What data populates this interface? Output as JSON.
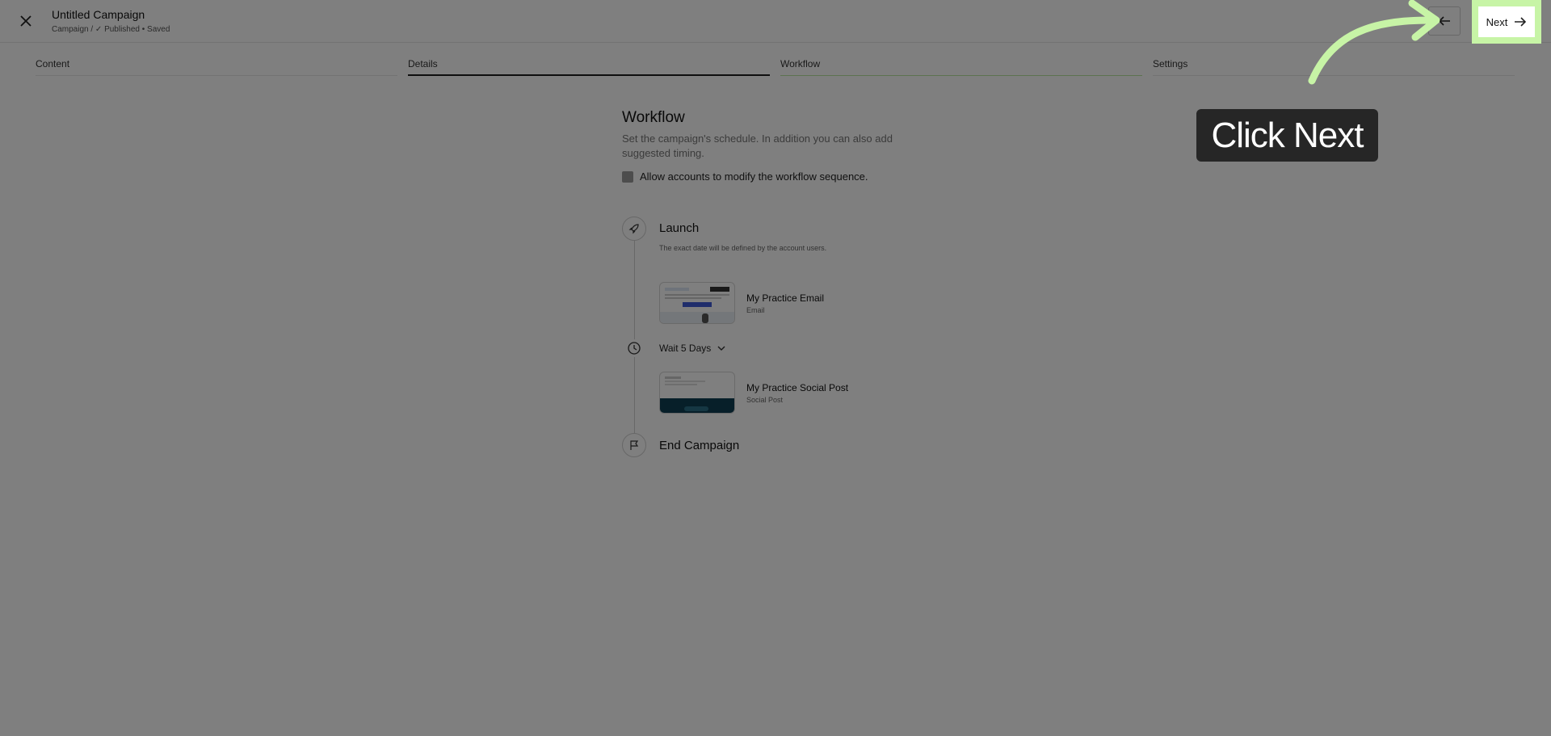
{
  "header": {
    "title": "Untitled Campaign",
    "subtitle": "Campaign / ✓ Published • Saved",
    "next_label": "Next"
  },
  "tabs": [
    {
      "label": "Content"
    },
    {
      "label": "Details"
    },
    {
      "label": "Workflow"
    },
    {
      "label": "Settings"
    }
  ],
  "workflow": {
    "title": "Workflow",
    "description": "Set the campaign's schedule. In addition you can also add suggested timing.",
    "checkbox_label": "Allow accounts to modify the workflow sequence.",
    "launch": {
      "title": "Launch",
      "note": "The exact date will be defined by the account users."
    },
    "items": [
      {
        "name": "My Practice Email",
        "type": "Email"
      },
      {
        "name": "My Practice Social Post",
        "type": "Social Post"
      }
    ],
    "wait_label": "Wait 5 Days",
    "end_label": "End Campaign"
  },
  "overlay": {
    "callout_text": "Click Next",
    "highlight_color": "#c7f4a6"
  },
  "icons": [
    "close-icon",
    "arrow-left-icon",
    "arrow-right-icon",
    "rocket-icon",
    "clock-icon",
    "chevron-down-icon",
    "flag-icon"
  ]
}
